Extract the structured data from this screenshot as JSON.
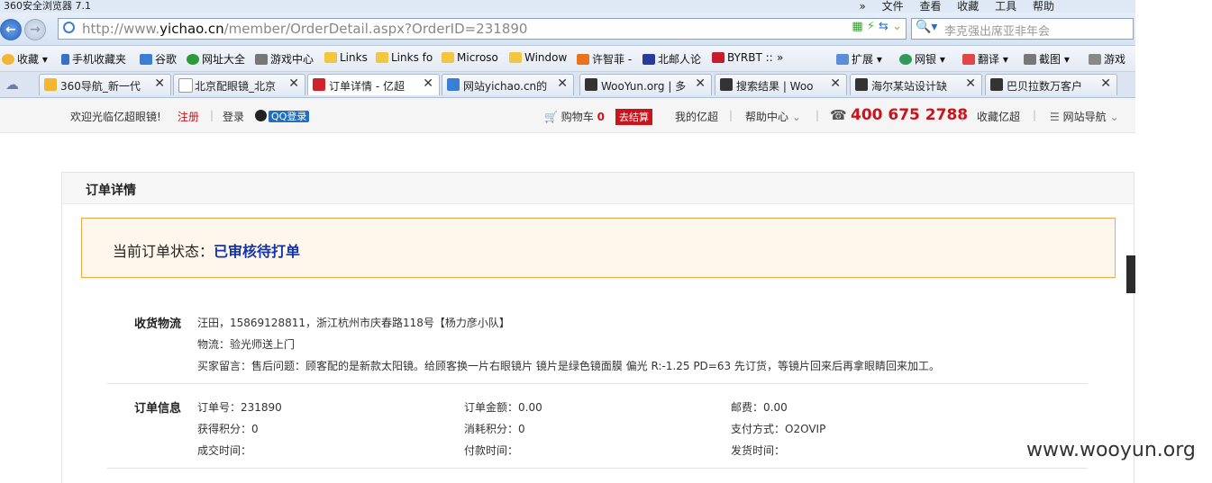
{
  "browser": {
    "title": "360安全浏览器 7.1",
    "menus": [
      "»",
      "文件",
      "查看",
      "收藏",
      "工具",
      "帮助"
    ],
    "url_prefix": "http://www.",
    "url_domain": "yichao.cn",
    "url_path": "/member/OrderDetail.aspx?OrderID=231890",
    "search_text": "李克强出席亚非年会"
  },
  "favorites": [
    "收藏",
    "手机收藏夹",
    "谷歌",
    "网址大全",
    "游戏中心",
    "Links",
    "Links fo",
    "Microso",
    "Window",
    "许智菲 -",
    "北邮人论",
    "BYRBT ::",
    "»",
    "扩展",
    "网银",
    "翻译",
    "截图",
    "游戏"
  ],
  "tabs": [
    "360导航_新一代",
    "北京配眼镜_北京",
    "订单详情 - 亿超",
    "网站yichao.cn的",
    "WooYun.org | 多",
    "搜索结果 | Woo",
    "海尔某站设计缺",
    "巴贝拉数万客户"
  ],
  "site": {
    "welcome": "欢迎光临亿超眼镜!",
    "register": "注册",
    "login": "登录",
    "qq_login": "QQ登录",
    "cart": "购物车",
    "cart_count": "0",
    "checkout": "去结算",
    "my_account": "我的亿超",
    "help": "帮助中心",
    "phone": "400 675 2788",
    "bookmark": "收藏亿超",
    "sitenav": "网站导航"
  },
  "order": {
    "panel_title": "订单详情",
    "status_label": "当前订单状态：",
    "status_value": "已审核待打单",
    "shipping_label": "收货物流",
    "shipping_address": "汪田，15869128811，浙江杭州市庆春路118号【杨力彦小队】",
    "logistics": "物流：验光师送上门",
    "buyer_note": "买家留言：售后问题：顾客配的是新款太阳镜。给顾客换一片右眼镜片 镜片是绿色镜面膜 偏光 R:-1.25 PD=63 先订货，等镜片回来后再拿眼睛回来加工。",
    "info_label": "订单信息",
    "order_no": "订单号：231890",
    "amount": "订单金额：0.00",
    "postage": "邮费：0.00",
    "points_earned": "获得积分：0",
    "points_used": "消耗积分：0",
    "payment": "支付方式：O2OVIP",
    "deal_time": "成交时间：",
    "pay_time": "付款时间：",
    "ship_time": "发货时间："
  },
  "watermark": "www.wooyun.org"
}
